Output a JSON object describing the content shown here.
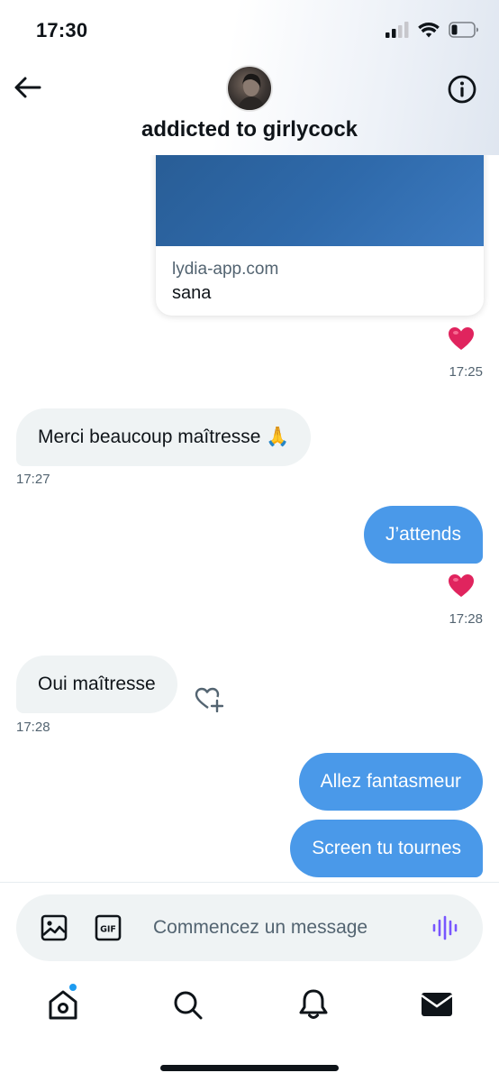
{
  "status_bar": {
    "time": "17:30"
  },
  "header": {
    "title": "addicted to girlycock"
  },
  "link_card": {
    "domain": "lydia-app.com",
    "title": "sana"
  },
  "messages": [
    {
      "direction": "received",
      "text": "Merci beaucoup maîtresse 🙏",
      "time": "17:27"
    },
    {
      "direction": "sent",
      "text": "J’attends",
      "time": "17:28",
      "reaction": "heart"
    },
    {
      "direction": "received",
      "text": "Oui maîtresse",
      "time": "17:28"
    },
    {
      "direction": "sent",
      "text": "Allez fantasmeur"
    },
    {
      "direction": "sent",
      "text": "Screen tu tournes"
    }
  ],
  "link_card_meta": {
    "time": "17:25",
    "reaction": "heart"
  },
  "composer": {
    "placeholder": "Commencez un message"
  },
  "colors": {
    "accent": "#1d9bf0",
    "sent_bubble": "#4a99e9",
    "received_bubble": "#eff3f4",
    "heart": "#e0245e",
    "voice": "#7856ff"
  },
  "icons": [
    "back-arrow-icon",
    "info-icon",
    "heart-icon",
    "add-reaction-icon",
    "image-icon",
    "gif-icon",
    "voice-icon",
    "home-icon",
    "search-icon",
    "bell-icon",
    "mail-icon"
  ]
}
